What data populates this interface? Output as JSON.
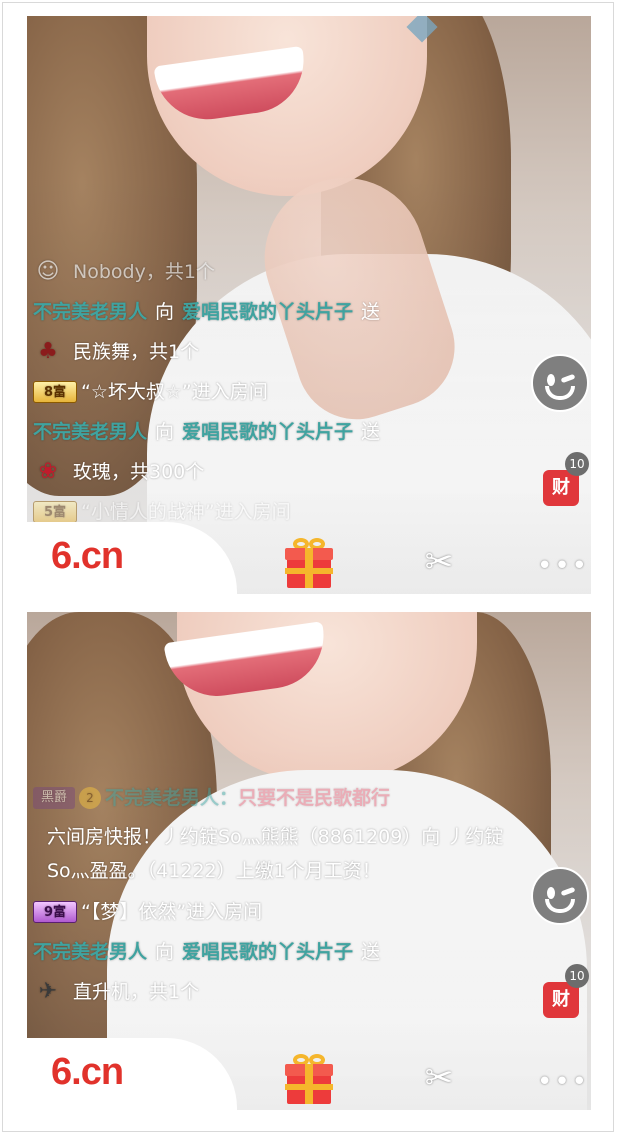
{
  "panels": [
    {
      "chat": [
        {
          "type": "nobody",
          "text": "Nobody，共1个"
        },
        {
          "type": "gift_line",
          "from": "不完美老男人",
          "verb": "向",
          "to": "爱唱民歌的丫头片子",
          "action": "送"
        },
        {
          "type": "gift_item",
          "icon": "dancer-icon",
          "glyph": "♣",
          "text": "民族舞，共1个"
        },
        {
          "type": "enter",
          "rich_level": "8富",
          "text": "“☆坏大叔☆”进入房间"
        },
        {
          "type": "gift_line",
          "from": "不完美老男人",
          "verb": "向",
          "to": "爱唱民歌的丫头片子",
          "action": "送"
        },
        {
          "type": "gift_item",
          "icon": "rose-icon",
          "glyph": "❀",
          "text": "玫瑰，共300个"
        },
        {
          "type": "enter",
          "rich_level": "5富",
          "text": "“小情人的战神”进入房间"
        }
      ],
      "wealth_label": "财",
      "wealth_count": "10",
      "logo": "6.cn"
    },
    {
      "chat": [
        {
          "type": "vip_chat",
          "vip": "黑爵",
          "crown": "2",
          "from": "不完美老男人：",
          "message": "只要不是民歌都行"
        },
        {
          "type": "notice",
          "text": "六间房快报！丿约锭So灬熊熊（8861209）向 丿约锭So灬盈盈。（41222）上缴1个月工资！"
        },
        {
          "type": "enter",
          "rich_level": "9富",
          "text": "“【梦】依然”进入房间"
        },
        {
          "type": "gift_line",
          "from": "不完美老男人",
          "verb": "向",
          "to": "爱唱民歌的丫头片子",
          "action": "送"
        },
        {
          "type": "gift_item",
          "icon": "helicopter-icon",
          "glyph": "✈",
          "text": "直升机，共1个"
        }
      ],
      "wealth_label": "财",
      "wealth_count": "10",
      "logo": "6.cn"
    }
  ],
  "icons": {
    "scissors": "✂",
    "more": "•••"
  },
  "colors": {
    "username": "#3fa3a0",
    "logo": "#e1322b",
    "wealth": "#e0373b",
    "gift_box": "#ed3b3b"
  }
}
